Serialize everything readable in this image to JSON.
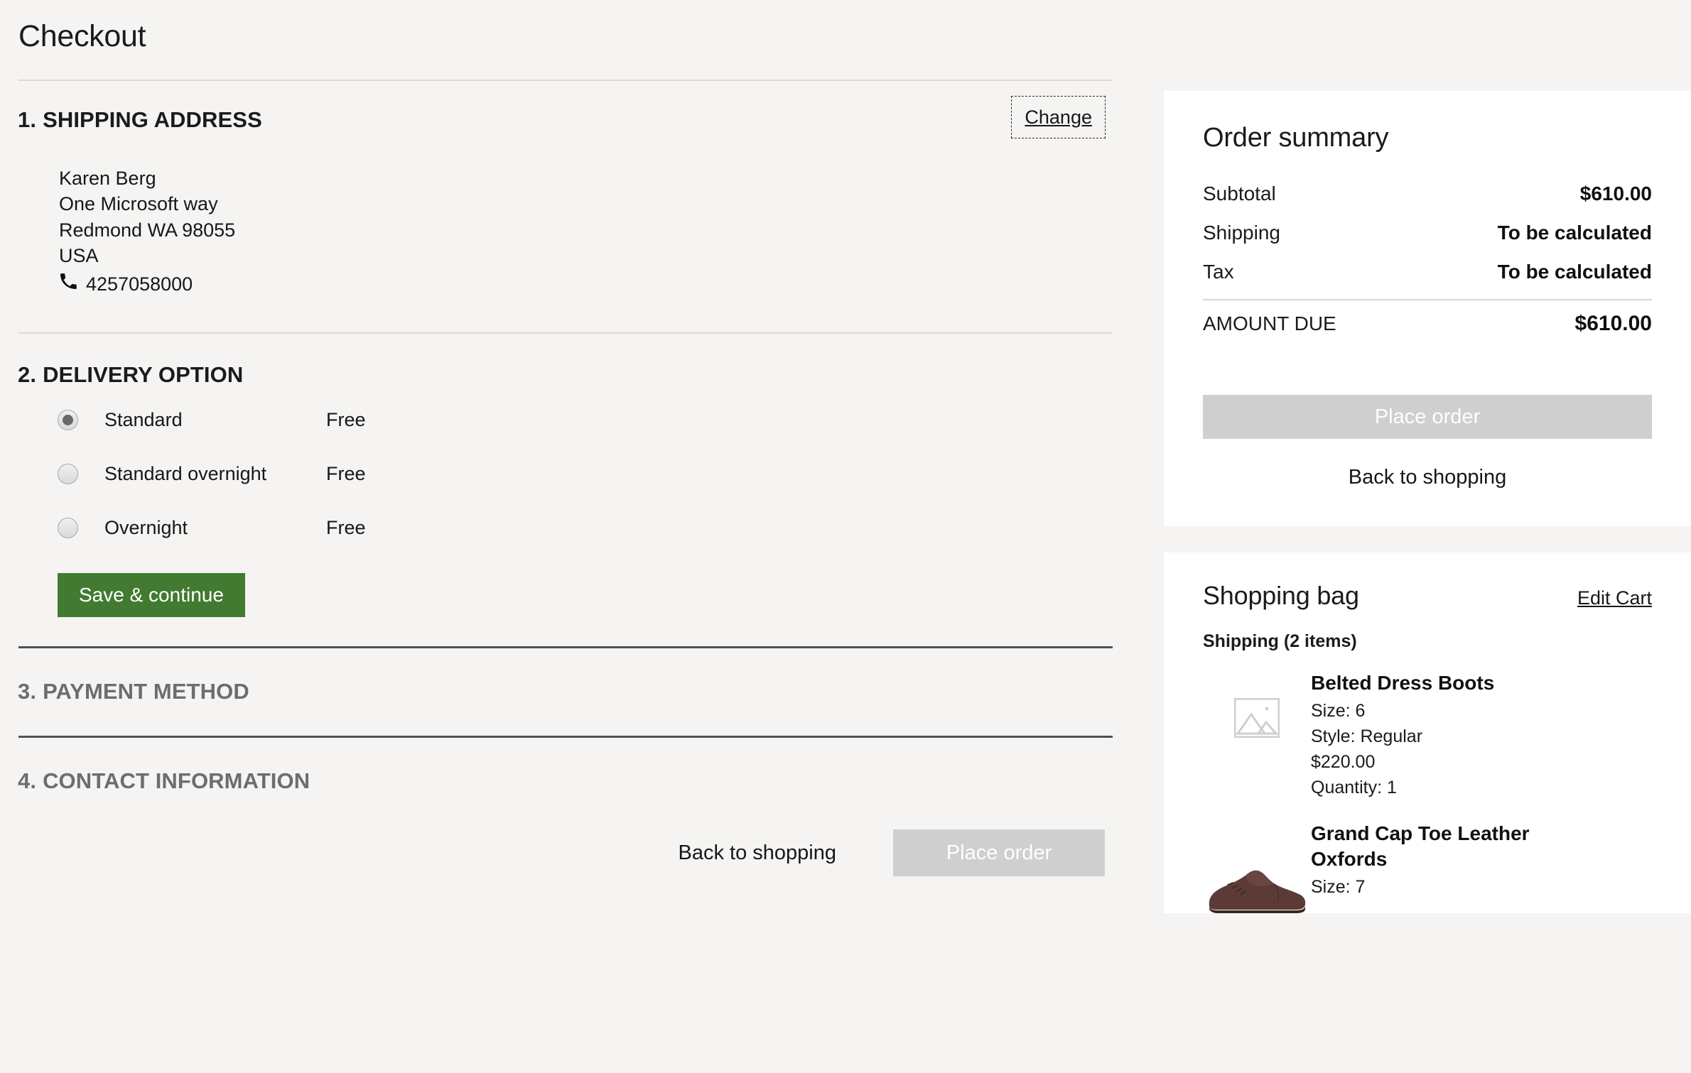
{
  "page": {
    "title": "Checkout"
  },
  "sections": {
    "shipping": {
      "number": "1.",
      "title": "SHIPPING ADDRESS",
      "change_label": "Change",
      "address": {
        "name": "Karen Berg",
        "street": "One Microsoft way",
        "city_state_zip": "Redmond WA  98055",
        "country": "USA",
        "phone": "4257058000",
        "phone_icon": "phone-icon"
      }
    },
    "delivery": {
      "number": "2.",
      "title": "DELIVERY OPTION",
      "options": [
        {
          "label": "Standard",
          "price": "Free",
          "selected": true
        },
        {
          "label": "Standard overnight",
          "price": "Free",
          "selected": false
        },
        {
          "label": "Overnight",
          "price": "Free",
          "selected": false
        }
      ],
      "save_label": "Save & continue"
    },
    "payment": {
      "number": "3.",
      "title": "PAYMENT METHOD"
    },
    "contact": {
      "number": "4.",
      "title": "CONTACT INFORMATION"
    }
  },
  "footer": {
    "back_label": "Back to shopping",
    "place_order_label": "Place order"
  },
  "order_summary": {
    "title": "Order summary",
    "rows": [
      {
        "label": "Subtotal",
        "value": "$610.00"
      },
      {
        "label": "Shipping",
        "value": "To be calculated"
      },
      {
        "label": "Tax",
        "value": "To be calculated"
      }
    ],
    "total_label": "AMOUNT DUE",
    "total_value": "$610.00",
    "place_order_label": "Place order",
    "back_label": "Back to shopping"
  },
  "shopping_bag": {
    "title": "Shopping bag",
    "edit_label": "Edit Cart",
    "group_label": "Shipping (2 items)",
    "items": [
      {
        "name": "Belted Dress Boots",
        "size": "Size: 6",
        "style": "Style: Regular",
        "price": "$220.00",
        "quantity": "Quantity: 1",
        "thumb": "image-placeholder-icon"
      },
      {
        "name": "Grand Cap Toe Leather Oxfords",
        "size": "Size: 7",
        "thumb": "shoe-photo"
      }
    ]
  },
  "colors": {
    "page_bg": "#f5f4f2",
    "card_bg": "#ffffff",
    "accent_green": "#417a30",
    "disabled_gray": "#cfcfcf",
    "muted_text": "#6a6e70",
    "divider_dark": "#4e5254",
    "shoe_brown": "#5c3b37"
  }
}
